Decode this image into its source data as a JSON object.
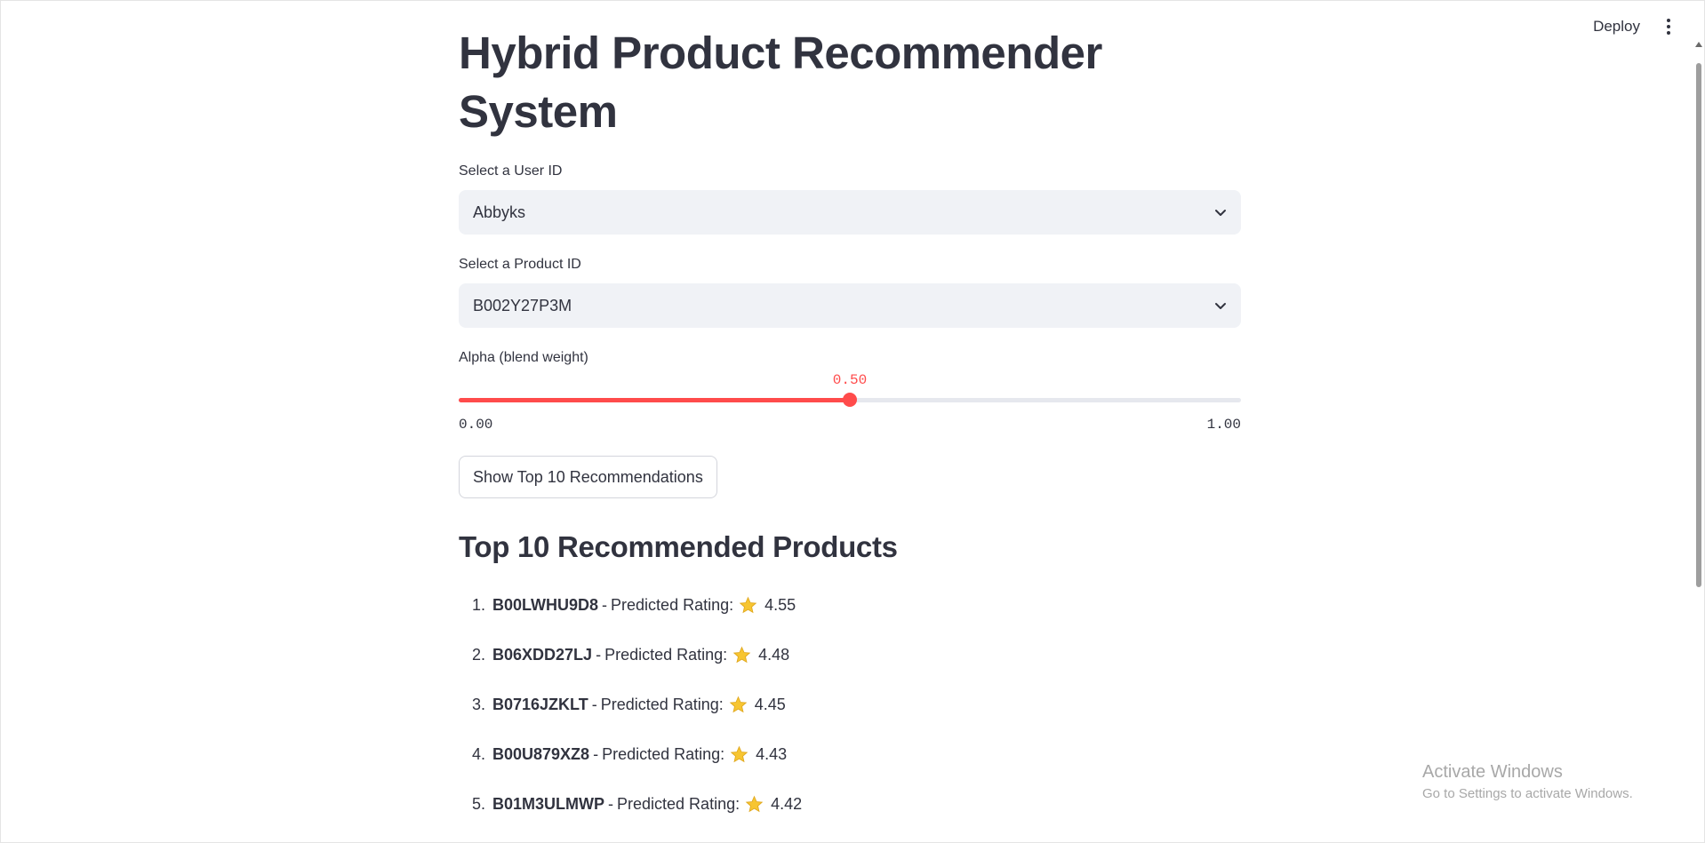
{
  "header": {
    "deploy_label": "Deploy",
    "menu_icon": "kebab-menu-icon"
  },
  "main": {
    "title": "Hybrid Product Recommender System",
    "user_select": {
      "label": "Select a User ID",
      "value": "Abbyks",
      "icon": "chevron-down-icon"
    },
    "product_select": {
      "label": "Select a Product ID",
      "value": "B002Y27P3M",
      "icon": "chevron-down-icon"
    },
    "alpha_slider": {
      "label": "Alpha (blend weight)",
      "value": 0.5,
      "value_label": "0.50",
      "min_label": "0.00",
      "max_label": "1.00",
      "accent": "#ff4b4b"
    },
    "show_button_label": "Show Top 10 Recommendations",
    "results_heading": "Top 10 Recommended Products",
    "rating_label": "Predicted Rating:",
    "star_icon": "star-icon",
    "recommendations": [
      {
        "rank": "1.",
        "product_id": "B00LWHU9D8",
        "rating": "4.55"
      },
      {
        "rank": "2.",
        "product_id": "B06XDD27LJ",
        "rating": "4.48"
      },
      {
        "rank": "3.",
        "product_id": "B0716JZKLT",
        "rating": "4.45"
      },
      {
        "rank": "4.",
        "product_id": "B00U879XZ8",
        "rating": "4.43"
      },
      {
        "rank": "5.",
        "product_id": "B01M3ULMWP",
        "rating": "4.42"
      }
    ]
  },
  "watermark": {
    "line1": "Activate Windows",
    "line2": "Go to Settings to activate Windows."
  }
}
